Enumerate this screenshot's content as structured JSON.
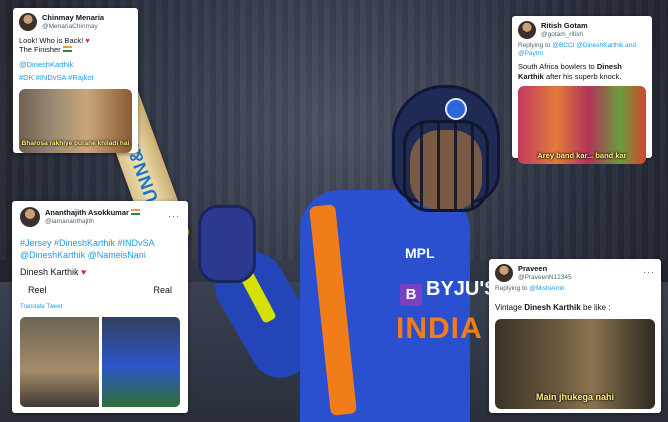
{
  "background": {
    "bat_brand": "GUNN&MOORE",
    "jersey_sponsor_1": "MPL",
    "jersey_sponsor_2": "BYJU'S",
    "jersey_byju_letter": "B",
    "jersey_team": "INDIA"
  },
  "tweets": [
    {
      "name": "Chinmay Menaria",
      "handle": "@MenariaChinmay",
      "line1": "Look! Who is Back!",
      "line2": "The Finisher",
      "mention": "@DineshKarthik",
      "hashtags": "#DK #INDvSA #Rajkot",
      "caption": "Bharosa rakhiye purane khiladi hai"
    },
    {
      "name": "Ritish Gotam",
      "handle": "@gotam_ritish",
      "reply_prefix": "Replying to",
      "reply_to": "@BCCI @DineshKarthik and @Paytm",
      "text_before": "South Africa bowlers to",
      "text_bold": "Dinesh Karthik",
      "text_after": "after his superb knock.",
      "caption": "Arey band kar... band kar"
    },
    {
      "name": "Ananthajith Asokkumar",
      "handle": "@iamananthajith",
      "dots": "···",
      "hashtags_1": "#Jersey #DineshKarthik #INDvSA",
      "hashtags_2": "@DineshKarthik @NameisNani",
      "body": "Dinesh Karthik",
      "reel": "Reel",
      "real": "Real",
      "translate": "Translate Tweet"
    },
    {
      "name": "Praveen",
      "handle": "@PraveenN12345",
      "dots": "···",
      "reply_prefix": "Replying to",
      "reply_to": "@MishiAmit",
      "text_before": "Vintage",
      "text_bold": "Dinesh Karthik",
      "text_after": "be like :",
      "caption": "Main jhukega nahi"
    }
  ],
  "colors": {
    "link": "#1d9bf0",
    "jersey_blue": "#2a4fcf",
    "jersey_orange": "#f07d1a",
    "caption_yellow": "#fff17a"
  }
}
